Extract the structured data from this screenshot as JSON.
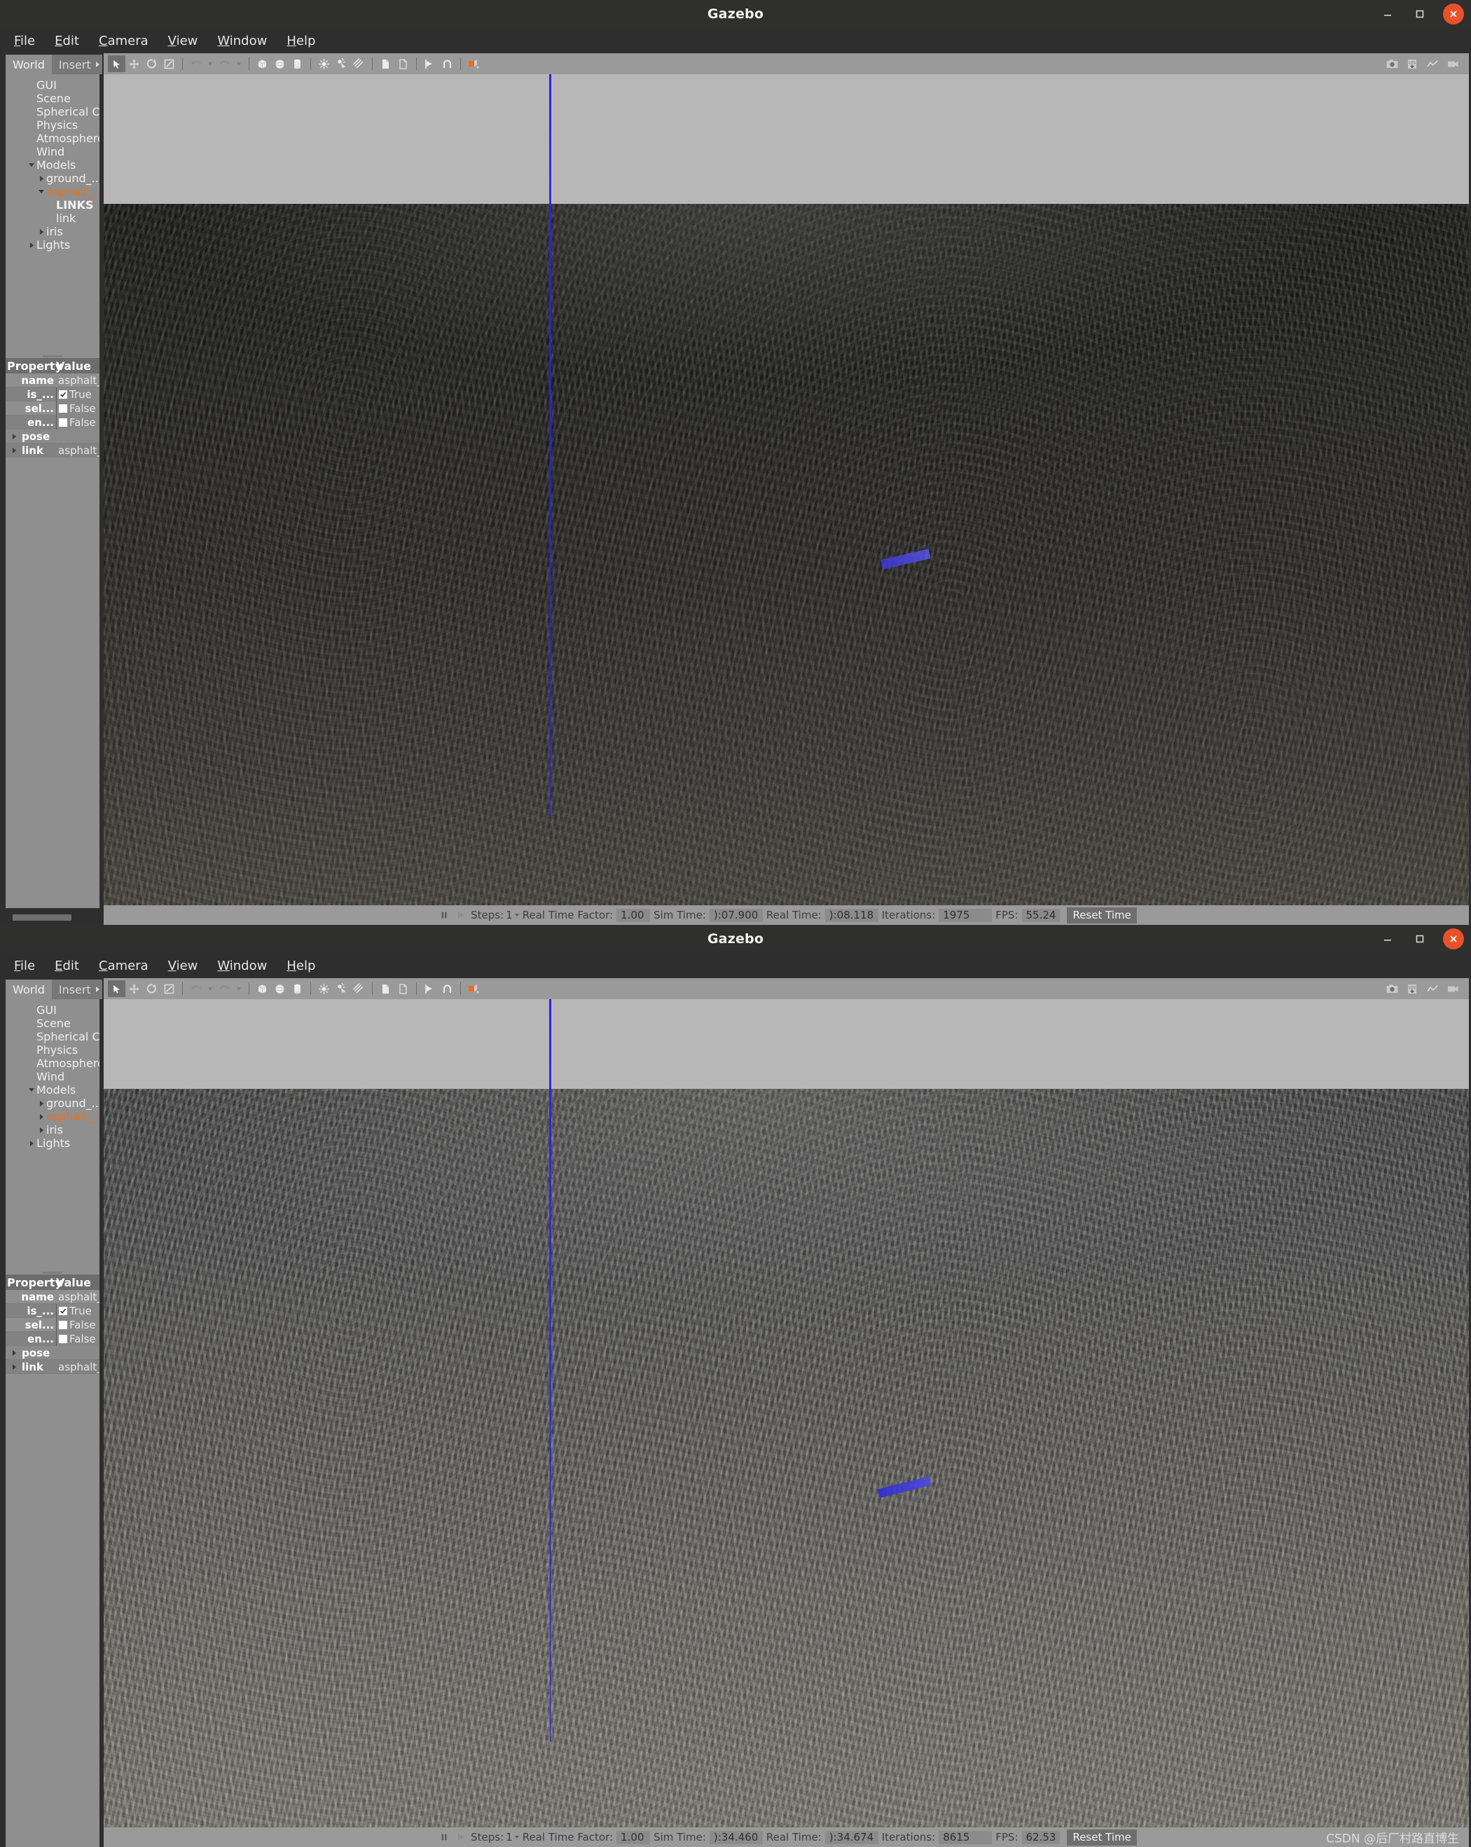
{
  "app": {
    "title": "Gazebo"
  },
  "window_controls": {
    "minimize": "minimize-icon",
    "maximize": "maximize-icon",
    "close": "close-icon",
    "close_color": "#e8512a"
  },
  "menu": {
    "items": [
      "File",
      "Edit",
      "Camera",
      "View",
      "Window",
      "Help"
    ]
  },
  "panel": {
    "tabs": [
      {
        "label": "World",
        "active": true
      },
      {
        "label": "Insert",
        "active": false
      }
    ],
    "tree_window1": [
      {
        "label": "GUI",
        "indent": 1,
        "twisty": "none",
        "style": "normal"
      },
      {
        "label": "Scene",
        "indent": 1,
        "twisty": "none",
        "style": "normal"
      },
      {
        "label": "Spherical Co...",
        "indent": 1,
        "twisty": "none",
        "style": "normal"
      },
      {
        "label": "Physics",
        "indent": 1,
        "twisty": "none",
        "style": "normal"
      },
      {
        "label": "Atmosphere",
        "indent": 1,
        "twisty": "none",
        "style": "normal"
      },
      {
        "label": "Wind",
        "indent": 1,
        "twisty": "none",
        "style": "normal"
      },
      {
        "label": "Models",
        "indent": 1,
        "twisty": "down",
        "style": "normal"
      },
      {
        "label": "ground_...",
        "indent": 2,
        "twisty": "right",
        "style": "normal"
      },
      {
        "label": "asphalt_...",
        "indent": 2,
        "twisty": "down",
        "style": "selected"
      },
      {
        "label": "LINKS",
        "indent": 3,
        "twisty": "none",
        "style": "bold"
      },
      {
        "label": "link",
        "indent": 3,
        "twisty": "none",
        "style": "normal"
      },
      {
        "label": "iris",
        "indent": 2,
        "twisty": "right",
        "style": "normal"
      },
      {
        "label": "Lights",
        "indent": 1,
        "twisty": "right",
        "style": "normal"
      }
    ],
    "tree_window2": [
      {
        "label": "GUI",
        "indent": 1,
        "twisty": "none",
        "style": "normal"
      },
      {
        "label": "Scene",
        "indent": 1,
        "twisty": "none",
        "style": "normal"
      },
      {
        "label": "Spherical Co...",
        "indent": 1,
        "twisty": "none",
        "style": "normal"
      },
      {
        "label": "Physics",
        "indent": 1,
        "twisty": "none",
        "style": "normal"
      },
      {
        "label": "Atmosphere",
        "indent": 1,
        "twisty": "none",
        "style": "normal"
      },
      {
        "label": "Wind",
        "indent": 1,
        "twisty": "none",
        "style": "normal"
      },
      {
        "label": "Models",
        "indent": 1,
        "twisty": "down",
        "style": "normal"
      },
      {
        "label": "ground_...",
        "indent": 2,
        "twisty": "right",
        "style": "normal"
      },
      {
        "label": "asphalt_...",
        "indent": 2,
        "twisty": "right",
        "style": "selected"
      },
      {
        "label": "iris",
        "indent": 2,
        "twisty": "right",
        "style": "normal"
      },
      {
        "label": "Lights",
        "indent": 1,
        "twisty": "right",
        "style": "normal"
      }
    ],
    "property_header": {
      "property": "Property",
      "value": "Value"
    },
    "properties": [
      {
        "key": "name",
        "value": "asphalt_p",
        "type": "text",
        "alt": false
      },
      {
        "key": "is_...",
        "value": "True",
        "type": "checkbox",
        "checked": true,
        "alt": true
      },
      {
        "key": "sel...",
        "value": "False",
        "type": "checkbox",
        "checked": false,
        "alt": false
      },
      {
        "key": "en...",
        "value": "False",
        "type": "checkbox",
        "checked": false,
        "alt": true
      },
      {
        "key": "pose",
        "value": "",
        "type": "expander",
        "alt": false
      },
      {
        "key": "link",
        "value": "asphalt_p",
        "type": "expander",
        "alt": true
      }
    ],
    "selected_tab": "World"
  },
  "toolbar": {
    "left_tools": [
      {
        "name": "select-arrow-icon",
        "active": true
      },
      {
        "name": "translate-icon",
        "active": false
      },
      {
        "name": "rotate-icon",
        "active": false
      },
      {
        "name": "scale-icon",
        "active": false
      }
    ],
    "history_tools": [
      {
        "name": "undo-icon"
      },
      {
        "name": "redo-icon"
      }
    ],
    "shape_tools": [
      {
        "name": "box-icon"
      },
      {
        "name": "sphere-icon"
      },
      {
        "name": "cylinder-icon"
      }
    ],
    "light_tools": [
      {
        "name": "point-light-icon"
      },
      {
        "name": "spot-light-icon"
      },
      {
        "name": "directional-light-icon"
      }
    ],
    "clipboard_tools": [
      {
        "name": "copy-icon"
      },
      {
        "name": "paste-icon"
      }
    ],
    "align_tools": [
      {
        "name": "align-icon"
      },
      {
        "name": "snap-icon"
      }
    ],
    "view_tools": [
      {
        "name": "view-angle-icon",
        "accent": "#ef6c1f"
      }
    ],
    "right_tools": [
      {
        "name": "screenshot-camera-icon"
      },
      {
        "name": "log-record-icon"
      },
      {
        "name": "plot-graph-icon"
      },
      {
        "name": "video-record-icon"
      }
    ]
  },
  "viewport": {
    "sky_color": "#b7b7b7",
    "axis_line_color": "#2a22e0",
    "window1_ground_top": "#1d1d1c",
    "window1_ground_bottom": "#3b3936",
    "window2_ground_top": "#4b4c4c",
    "window2_ground_bottom": "#6a6863"
  },
  "status_window1": {
    "pause_icon": "pause-icon",
    "step_icon": "step-forward-icon",
    "steps_label": "Steps:",
    "steps_value": "1",
    "rtf_label": "Real Time Factor:",
    "rtf_value": "1.00",
    "sim_time_label": "Sim Time:",
    "sim_time_value": "):07.900",
    "real_time_label": "Real Time:",
    "real_time_value": "):08.118",
    "iterations_label": "Iterations:",
    "iterations_value": "1975",
    "fps_label": "FPS:",
    "fps_value": "55.24",
    "reset_button": "Reset Time"
  },
  "status_window2": {
    "pause_icon": "pause-icon",
    "step_icon": "step-forward-icon",
    "steps_label": "Steps:",
    "steps_value": "1",
    "rtf_label": "Real Time Factor:",
    "rtf_value": "1.00",
    "sim_time_label": "Sim Time:",
    "sim_time_value": "):34.460",
    "real_time_label": "Real Time:",
    "real_time_value": "):34.674",
    "iterations_label": "Iterations:",
    "iterations_value": "8615",
    "fps_label": "FPS:",
    "fps_value": "62.53",
    "reset_button": "Reset Time"
  },
  "watermark": {
    "text": "CSDN @后厂村路直博生"
  }
}
